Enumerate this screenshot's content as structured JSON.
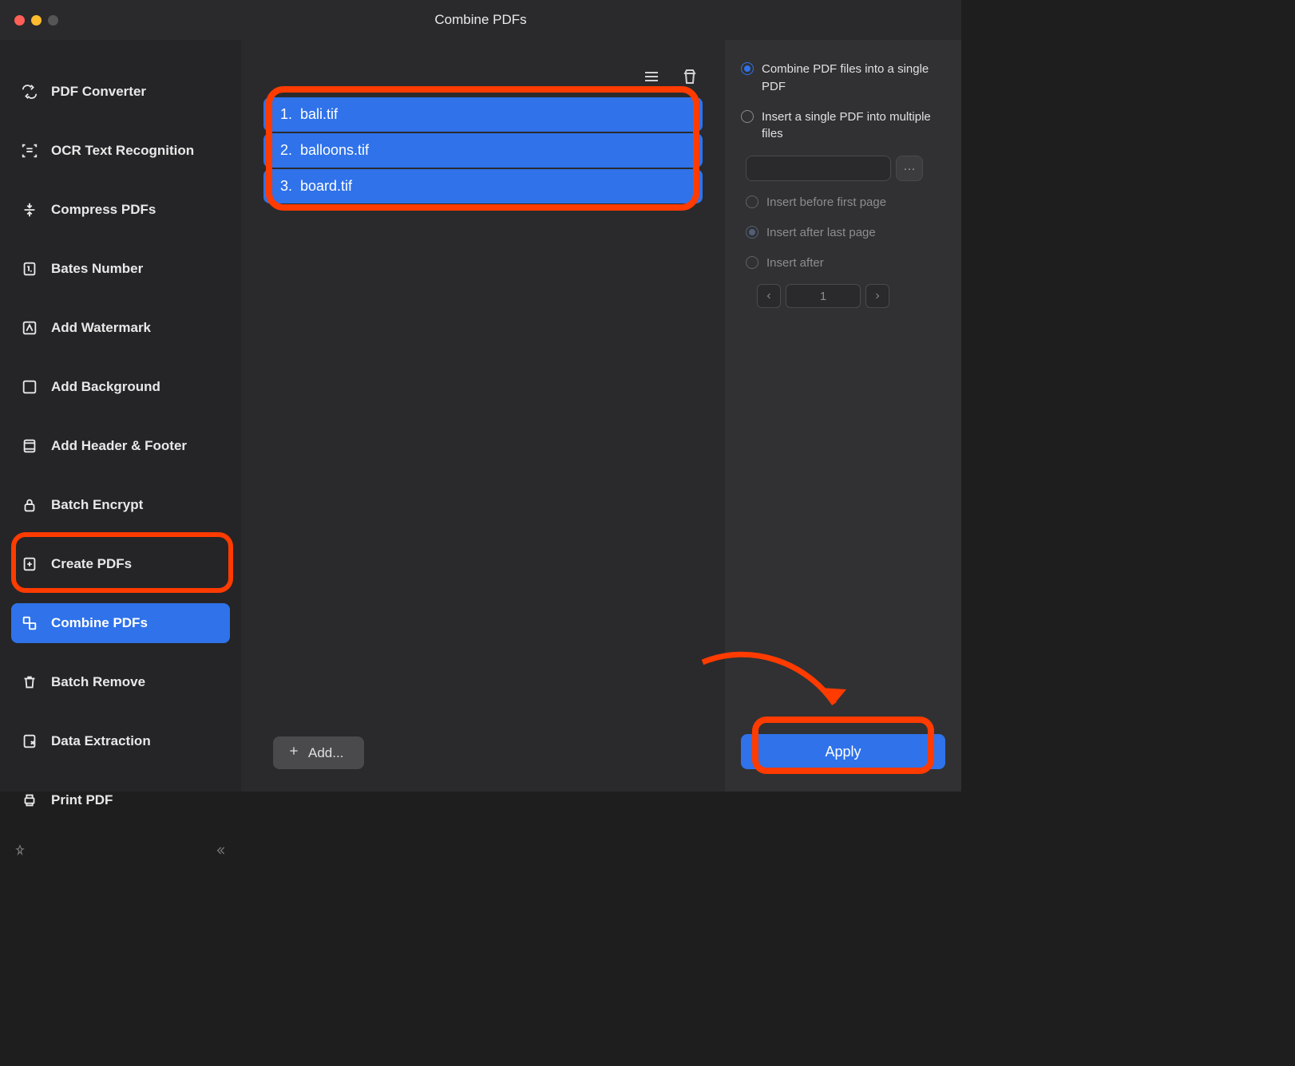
{
  "window": {
    "title": "Combine PDFs"
  },
  "sidebar": {
    "items": [
      {
        "label": "PDF Converter",
        "name": "sidebar-item-pdf-converter"
      },
      {
        "label": "OCR Text Recognition",
        "name": "sidebar-item-ocr"
      },
      {
        "label": "Compress PDFs",
        "name": "sidebar-item-compress"
      },
      {
        "label": "Bates Number",
        "name": "sidebar-item-bates"
      },
      {
        "label": "Add Watermark",
        "name": "sidebar-item-watermark"
      },
      {
        "label": "Add Background",
        "name": "sidebar-item-background"
      },
      {
        "label": "Add Header & Footer",
        "name": "sidebar-item-header-footer"
      },
      {
        "label": "Batch Encrypt",
        "name": "sidebar-item-encrypt"
      },
      {
        "label": "Create PDFs",
        "name": "sidebar-item-create"
      },
      {
        "label": "Combine PDFs",
        "name": "sidebar-item-combine"
      },
      {
        "label": "Batch Remove",
        "name": "sidebar-item-remove"
      },
      {
        "label": "Data Extraction",
        "name": "sidebar-item-extract"
      },
      {
        "label": "Print PDF",
        "name": "sidebar-item-print"
      }
    ],
    "active_index": 9
  },
  "files": [
    {
      "num": "1.",
      "name": "bali.tif"
    },
    {
      "num": "2.",
      "name": "balloons.tif"
    },
    {
      "num": "3.",
      "name": "board.tif"
    }
  ],
  "add_button": "Add...",
  "panel": {
    "option_combine": "Combine PDF files into a single PDF",
    "option_insert": "Insert a single PDF into multiple files",
    "insert_before": "Insert before first page",
    "insert_after_last": "Insert after last page",
    "insert_after": "Insert after",
    "page_value": "1",
    "apply": "Apply"
  }
}
